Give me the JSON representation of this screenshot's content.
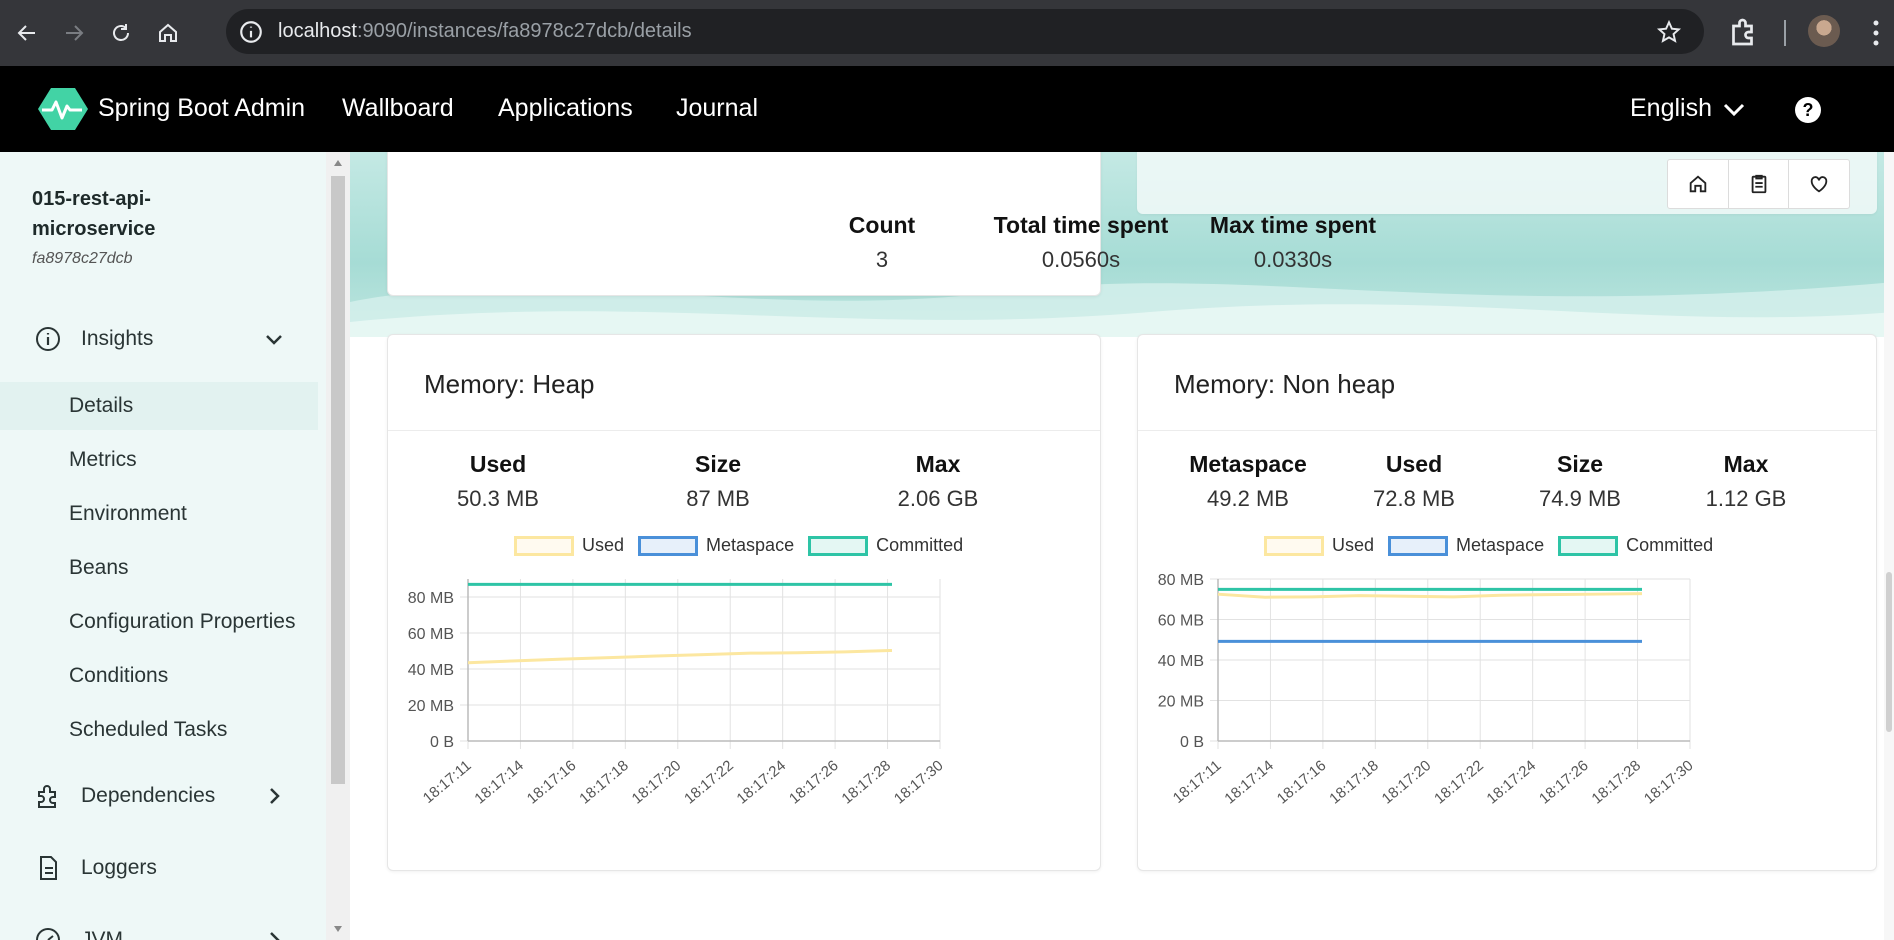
{
  "browser": {
    "url_host": "localhost",
    "url_path": ":9090/instances/fa8978c27dcb/details"
  },
  "header": {
    "brand": "Spring Boot Admin",
    "nav": [
      "Wallboard",
      "Applications",
      "Journal"
    ],
    "language": "English",
    "help": "?"
  },
  "sidebar": {
    "instance_name": "015-rest-api-microservice",
    "instance_id": "fa8978c27dcb",
    "groups": {
      "insights": "Insights",
      "dependencies": "Dependencies",
      "loggers": "Loggers",
      "jvm": "JVM"
    },
    "items": [
      "Details",
      "Metrics",
      "Environment",
      "Beans",
      "Configuration Properties",
      "Conditions",
      "Scheduled Tasks"
    ],
    "active_item": "Details"
  },
  "gc_card": {
    "stats": [
      {
        "label": "Count",
        "value": "3"
      },
      {
        "label": "Total time spent",
        "value": "0.0560s"
      },
      {
        "label": "Max time spent",
        "value": "0.0330s"
      }
    ]
  },
  "heap_card": {
    "title": "Memory: Heap",
    "stats": [
      {
        "label": "Used",
        "value": "50.3 MB"
      },
      {
        "label": "Size",
        "value": "87 MB"
      },
      {
        "label": "Max",
        "value": "2.06 GB"
      }
    ]
  },
  "nonheap_card": {
    "title": "Memory: Non heap",
    "stats": [
      {
        "label": "Metaspace",
        "value": "49.2 MB"
      },
      {
        "label": "Used",
        "value": "72.8 MB"
      },
      {
        "label": "Size",
        "value": "74.9 MB"
      },
      {
        "label": "Max",
        "value": "1.12 GB"
      }
    ]
  },
  "colors": {
    "used": "#fce7a0",
    "metaspace": "#4a90d9",
    "committed": "#2ec4a6",
    "accent": "#42d3a5"
  },
  "chart_data": [
    {
      "type": "line",
      "x": [
        "18:17:11",
        "18:17:14",
        "18:17:16",
        "18:17:18",
        "18:17:20",
        "18:17:22",
        "18:17:24",
        "18:17:26",
        "18:17:28",
        "18:17:30"
      ],
      "yticks": [
        "0 B",
        "20 MB",
        "40 MB",
        "60 MB",
        "80 MB"
      ],
      "ylim": [
        0,
        90
      ],
      "series": [
        {
          "name": "Used",
          "color": "#fce7a0",
          "values": [
            43.5,
            44.5,
            45.5,
            46.3,
            47.2,
            48.0,
            48.8,
            49.0,
            49.5,
            50.3
          ]
        },
        {
          "name": "Metaspace",
          "color": "#4a90d9",
          "values": []
        },
        {
          "name": "Committed",
          "color": "#2ec4a6",
          "values": [
            87,
            87,
            87,
            87,
            87,
            87,
            87,
            87,
            87,
            87
          ]
        }
      ]
    },
    {
      "type": "line",
      "x": [
        "18:17:11",
        "18:17:14",
        "18:17:16",
        "18:17:18",
        "18:17:20",
        "18:17:22",
        "18:17:24",
        "18:17:26",
        "18:17:28",
        "18:17:30"
      ],
      "yticks": [
        "0 B",
        "20 MB",
        "40 MB",
        "60 MB",
        "80 MB"
      ],
      "ylim": [
        0,
        80
      ],
      "series": [
        {
          "name": "Used",
          "color": "#fce7a0",
          "values": [
            72.5,
            71,
            71.2,
            71.8,
            71.5,
            71.2,
            72,
            72.3,
            72.5,
            72.8
          ]
        },
        {
          "name": "Metaspace",
          "color": "#4a90d9",
          "values": [
            49.2,
            49.2,
            49.2,
            49.2,
            49.2,
            49.2,
            49.2,
            49.2,
            49.2,
            49.2
          ]
        },
        {
          "name": "Committed",
          "color": "#2ec4a6",
          "values": [
            74.9,
            74.9,
            74.9,
            74.9,
            74.9,
            74.9,
            74.9,
            74.9,
            74.9,
            74.9
          ]
        }
      ]
    }
  ]
}
